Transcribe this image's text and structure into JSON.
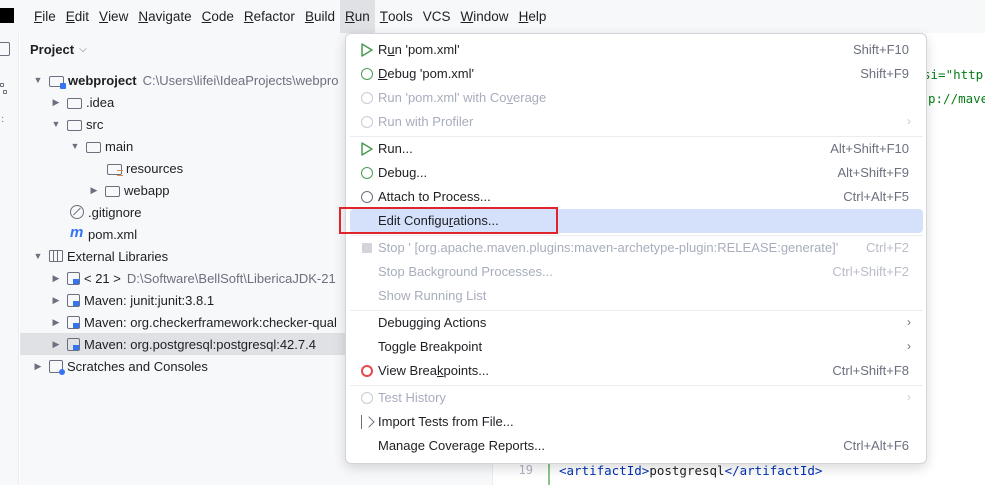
{
  "menubar": {
    "items": [
      {
        "label": "File",
        "mnemonic": "F",
        "rest": "ile"
      },
      {
        "label": "Edit",
        "mnemonic": "E",
        "rest": "dit"
      },
      {
        "label": "View",
        "mnemonic": "V",
        "rest": "iew"
      },
      {
        "label": "Navigate",
        "mnemonic": "N",
        "rest": "avigate"
      },
      {
        "label": "Code",
        "mnemonic": "C",
        "rest": "ode"
      },
      {
        "label": "Refactor",
        "mnemonic": "R",
        "rest": "efactor"
      },
      {
        "label": "Build",
        "mnemonic": "B",
        "rest": "uild"
      },
      {
        "label": "Run",
        "mnemonic": "R",
        "rest": "un"
      },
      {
        "label": "Tools",
        "mnemonic": "T",
        "rest": "ools"
      },
      {
        "label": "VCS",
        "mnemonic": "",
        "rest": "VCS"
      },
      {
        "label": "Window",
        "mnemonic": "W",
        "rest": "indow"
      },
      {
        "label": "Help",
        "mnemonic": "H",
        "rest": "elp"
      }
    ]
  },
  "project": {
    "title": "Project",
    "tree": [
      {
        "label": "webproject",
        "path": "C:\\Users\\lifei\\IdeaProjects\\webpro"
      },
      {
        "label": ".idea"
      },
      {
        "label": "src"
      },
      {
        "label": "main"
      },
      {
        "label": "resources"
      },
      {
        "label": "webapp"
      },
      {
        "label": ".gitignore"
      },
      {
        "label": "pom.xml"
      },
      {
        "label": "External Libraries"
      },
      {
        "label": "< 21 >",
        "path": "D:\\Software\\BellSoft\\LibericaJDK-21"
      },
      {
        "label": "Maven: junit:junit:3.8.1"
      },
      {
        "label": "Maven: org.checkerframework:checker-qual"
      },
      {
        "label": "Maven: org.postgresql:postgresql:42.7.4"
      },
      {
        "label": "Scratches and Consoles"
      }
    ]
  },
  "editor": {
    "snippet1": "si=\"http:/",
    "snippet2": "p://maven",
    "line_number": "19",
    "last_line": {
      "open_tag": "<artifactId>",
      "text": "postgresql",
      "close_tag": "</artifactId>"
    }
  },
  "run_menu": {
    "items": [
      {
        "pre": "R",
        "ul": "u",
        "post": "n 'pom.xml'",
        "shortcut": "Shift+F10"
      },
      {
        "pre": "",
        "ul": "D",
        "post": "ebug 'pom.xml'",
        "shortcut": "Shift+F9"
      },
      {
        "pre": "Run 'pom.xml' with Co",
        "ul": "v",
        "post": "erage",
        "shortcut": ""
      },
      {
        "pre": "Run with Profiler",
        "ul": "",
        "post": "",
        "shortcut": ""
      },
      {
        "pre": "Run...",
        "ul": "",
        "post": "",
        "shortcut": "Alt+Shift+F10"
      },
      {
        "pre": "Debug...",
        "ul": "",
        "post": "",
        "shortcut": "Alt+Shift+F9"
      },
      {
        "pre": "Attach to Process...",
        "ul": "",
        "post": "",
        "shortcut": "Ctrl+Alt+F5"
      },
      {
        "pre": "Edit Configu",
        "ul": "r",
        "post": "ations...",
        "shortcut": ""
      },
      {
        "pre": "Stop ' [org.apache.maven.plugins:maven-archetype-plugin:RELEASE:generate]'",
        "ul": "",
        "post": "",
        "shortcut": "Ctrl+F2"
      },
      {
        "pre": "Stop Background Processes...",
        "ul": "",
        "post": "",
        "shortcut": "Ctrl+Shift+F2"
      },
      {
        "pre": "Show Running List",
        "ul": "",
        "post": "",
        "shortcut": ""
      },
      {
        "pre": "Debugging Actions",
        "ul": "",
        "post": "",
        "shortcut": ""
      },
      {
        "pre": "Toggle Breakpoint",
        "ul": "",
        "post": "",
        "shortcut": ""
      },
      {
        "pre": "View Brea",
        "ul": "k",
        "post": "points...",
        "shortcut": "Ctrl+Shift+F8"
      },
      {
        "pre": "Test History",
        "ul": "",
        "post": "",
        "shortcut": ""
      },
      {
        "pre": "Import Tests from File...",
        "ul": "",
        "post": "",
        "shortcut": ""
      },
      {
        "pre": "Manage Coverage Reports...",
        "ul": "",
        "post": "",
        "shortcut": "Ctrl+Alt+F6"
      }
    ]
  },
  "colors": {
    "accent": "#3574f0",
    "run_green": "#499c54",
    "highlight_red": "#e0242c",
    "hover_bg": "#d5e1fb"
  }
}
